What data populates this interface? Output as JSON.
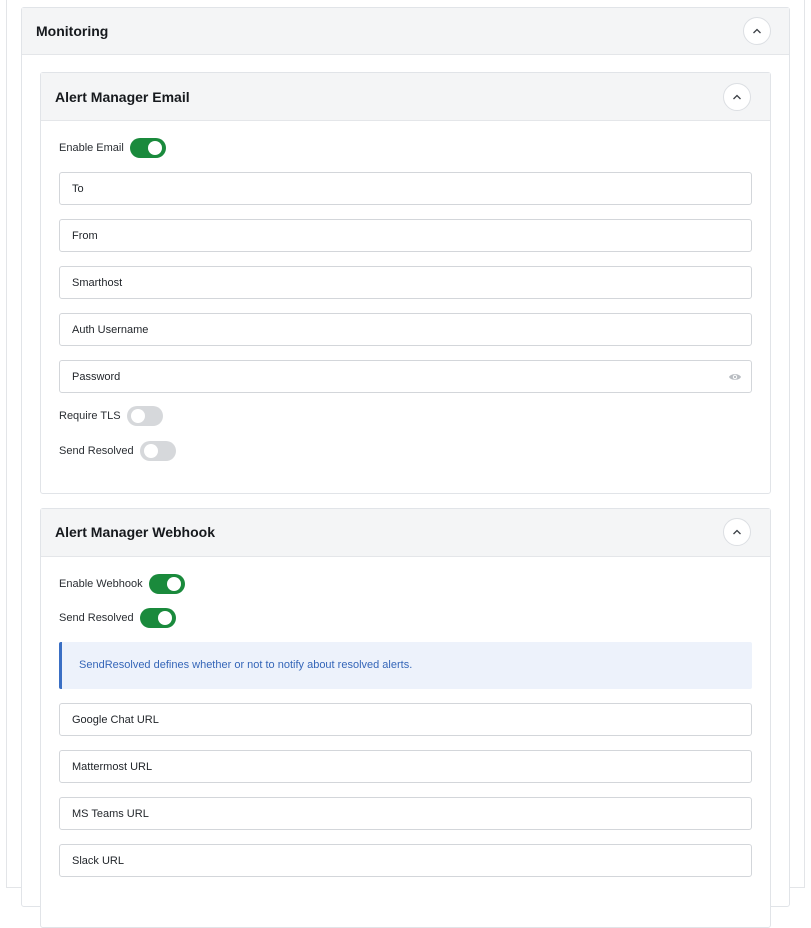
{
  "monitoring": {
    "title": "Monitoring"
  },
  "email": {
    "title": "Alert Manager Email",
    "enable_label": "Enable Email",
    "enable_on": true,
    "fields": {
      "to": "To",
      "from": "From",
      "smarthost": "Smarthost",
      "auth_username": "Auth Username",
      "password": "Password"
    },
    "require_tls_label": "Require TLS",
    "require_tls_on": false,
    "send_resolved_label": "Send Resolved",
    "send_resolved_on": false
  },
  "webhook": {
    "title": "Alert Manager Webhook",
    "enable_label": "Enable Webhook",
    "enable_on": true,
    "send_resolved_label": "Send Resolved",
    "send_resolved_on": true,
    "info": "SendResolved defines whether or not to notify about resolved alerts.",
    "fields": {
      "google_chat": "Google Chat URL",
      "mattermost": "Mattermost URL",
      "ms_teams": "MS Teams URL",
      "slack": "Slack URL"
    }
  },
  "icons": {
    "collapse": "chevron-up-icon",
    "password_toggle": "eye-icon"
  },
  "colors": {
    "toggle_on": "#1a8a3c",
    "toggle_off": "#d6d8db",
    "info_accent": "#3a6fc4",
    "info_text": "#3566b8"
  }
}
